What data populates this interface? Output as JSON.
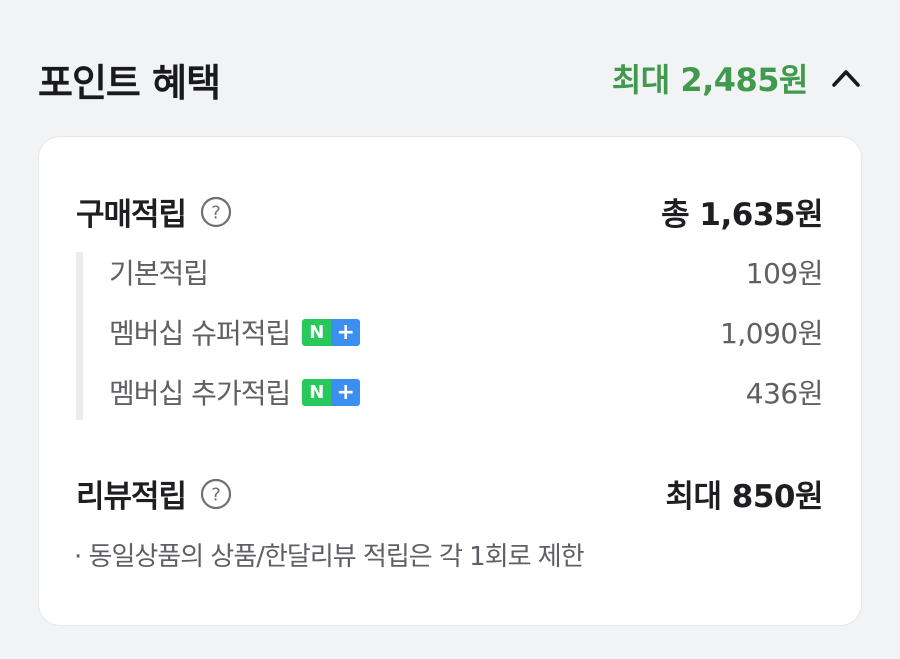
{
  "header": {
    "title": "포인트 혜택",
    "max_benefit": "최대 2,485원",
    "collapse_icon": "chevron-up-icon",
    "accent_color": "#3f9a4d"
  },
  "purchase": {
    "label": "구매적립",
    "help_icon": "question-circle-icon",
    "total": "총 1,635원",
    "items": [
      {
        "label": "기본적립",
        "value": "109원",
        "badge": false
      },
      {
        "label": "멤버십 슈퍼적립",
        "value": "1,090원",
        "badge": true
      },
      {
        "label": "멤버십 추가적립",
        "value": "436원",
        "badge": true
      }
    ]
  },
  "badge": {
    "n": "N",
    "plus": "+",
    "n_color": "#26c95a",
    "plus_color": "#3b8ff0"
  },
  "review": {
    "label": "리뷰적립",
    "help_icon": "question-circle-icon",
    "max": "최대 850원"
  },
  "note": "· 동일상품의 상품/한달리뷰 적립은 각 1회로 제한"
}
